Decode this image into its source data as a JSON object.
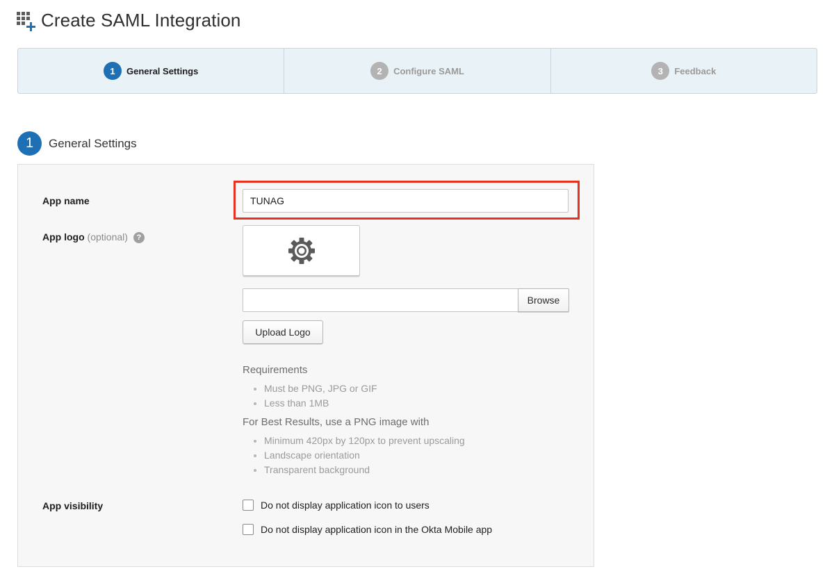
{
  "page": {
    "title": "Create SAML Integration",
    "icon": "add-app-grid-icon"
  },
  "wizard": {
    "steps": [
      {
        "number": "1",
        "label": "General Settings",
        "active": true
      },
      {
        "number": "2",
        "label": "Configure SAML",
        "active": false
      },
      {
        "number": "3",
        "label": "Feedback",
        "active": false
      }
    ]
  },
  "section": {
    "number": "1",
    "title": "General Settings"
  },
  "form": {
    "app_name": {
      "label": "App name",
      "value": "TUNAG"
    },
    "app_logo": {
      "label": "App logo",
      "optional": "(optional)",
      "help": "?",
      "preview_icon": "gear-icon",
      "browse_label": "Browse",
      "upload_label": "Upload Logo"
    },
    "requirements": {
      "title": "Requirements",
      "items": [
        "Must be PNG, JPG or GIF",
        "Less than 1MB"
      ]
    },
    "best_results": {
      "title": "For Best Results, use a PNG image with",
      "items": [
        "Minimum 420px by 120px to prevent upscaling",
        "Landscape orientation",
        "Transparent background"
      ]
    },
    "app_visibility": {
      "label": "App visibility",
      "options": [
        {
          "label": "Do not display application icon to users",
          "checked": false
        },
        {
          "label": "Do not display application icon in the Okta Mobile app",
          "checked": false
        }
      ]
    }
  },
  "colors": {
    "accent": "#1f6fb4",
    "highlight": "#e8321f",
    "wizard_bg": "#e9f2f6"
  }
}
